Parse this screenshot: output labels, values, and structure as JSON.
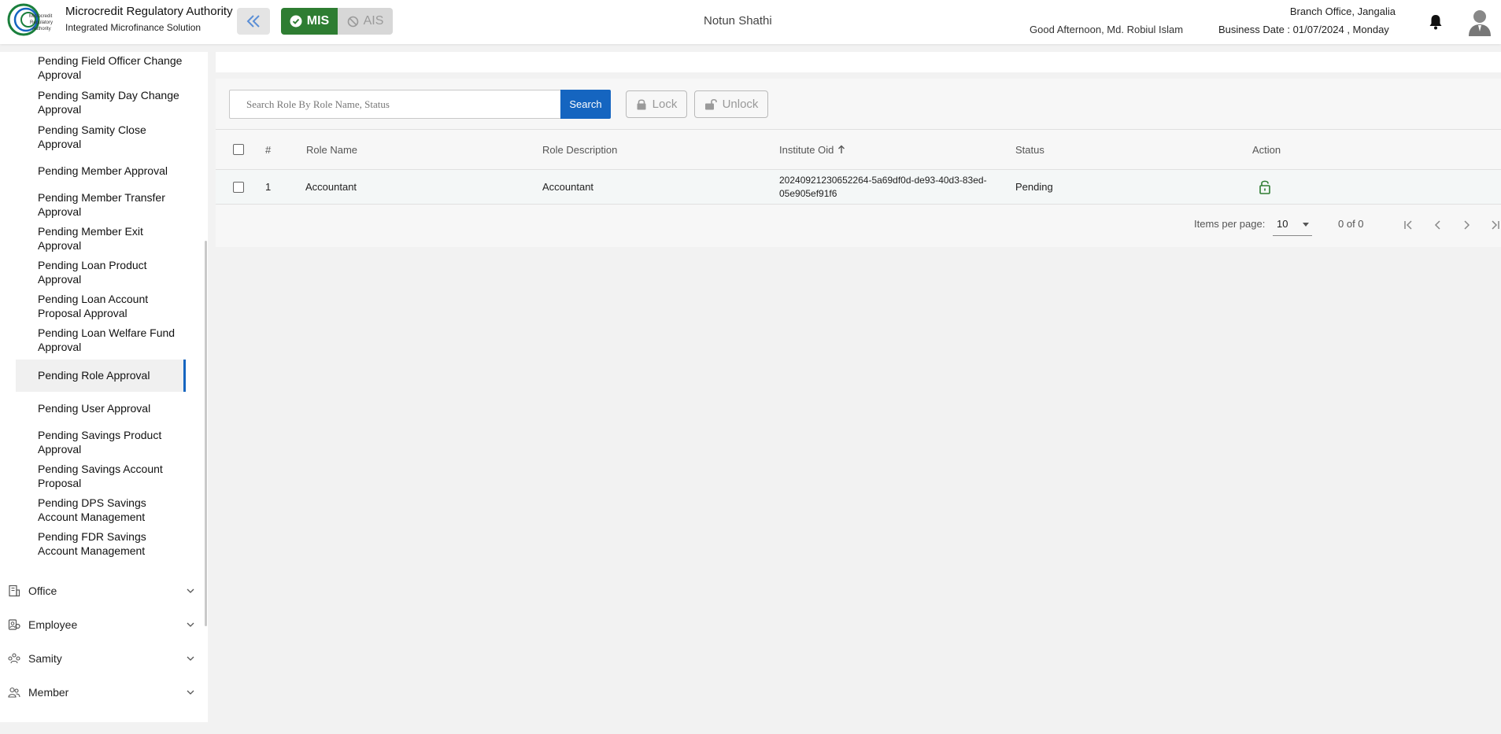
{
  "header": {
    "brand_title": "Microcredit Regulatory Authority",
    "brand_subtitle": "Integrated Microfinance Solution",
    "logo_text": "Microcredit Regulatory Authority",
    "mis_label": "MIS",
    "ais_label": "AIS",
    "app_name": "Notun Shathi",
    "greeting": "Good Afternoon, Md. Robiul Islam",
    "branch": "Branch Office, Jangalia",
    "business_date": "Business Date : 01/07/2024 , Monday",
    "accent_color": "#2e7d32"
  },
  "sidebar": {
    "sub_items": [
      {
        "label": "Pending Field Officer Change Approval"
      },
      {
        "label": "Pending Samity Day Change Approval"
      },
      {
        "label": "Pending Samity Close Approval"
      },
      {
        "label": "Pending Member Approval"
      },
      {
        "label": "Pending Member Transfer Approval"
      },
      {
        "label": "Pending Member Exit Approval"
      },
      {
        "label": "Pending Loan Product Approval"
      },
      {
        "label": "Pending Loan Account Proposal Approval"
      },
      {
        "label": "Pending Loan Welfare Fund Approval"
      },
      {
        "label": "Pending Role Approval"
      },
      {
        "label": "Pending User Approval"
      },
      {
        "label": "Pending Savings Product Approval"
      },
      {
        "label": "Pending Savings Account Proposal"
      },
      {
        "label": "Pending DPS Savings Account Management"
      },
      {
        "label": "Pending FDR Savings Account Management"
      }
    ],
    "active_item": "Pending Role Approval",
    "groups": [
      {
        "label": "Office",
        "icon": "office-icon"
      },
      {
        "label": "Employee",
        "icon": "employee-icon"
      },
      {
        "label": "Samity",
        "icon": "samity-icon"
      },
      {
        "label": "Member",
        "icon": "member-icon"
      }
    ]
  },
  "toolbar": {
    "search_placeholder": "Search Role By Role Name, Status",
    "search_label": "Search",
    "lock_label": "Lock",
    "unlock_label": "Unlock"
  },
  "table": {
    "columns": [
      "#",
      "Role Name",
      "Role Description",
      "Institute Oid",
      "Status",
      "Action"
    ],
    "sort_column": "Institute Oid",
    "rows": [
      {
        "index": "1",
        "role_name": "Accountant",
        "role_description": "Accountant",
        "institute_oid_line1": "20240921230652264-5a69df0d-de93-40d3-83ed-",
        "institute_oid_line2": "05e905ef91f6",
        "status": "Pending",
        "action_icon": "unlock-icon"
      }
    ]
  },
  "paginator": {
    "items_per_page_label": "Items per page:",
    "page_size": "10",
    "range": "0 of 0"
  }
}
